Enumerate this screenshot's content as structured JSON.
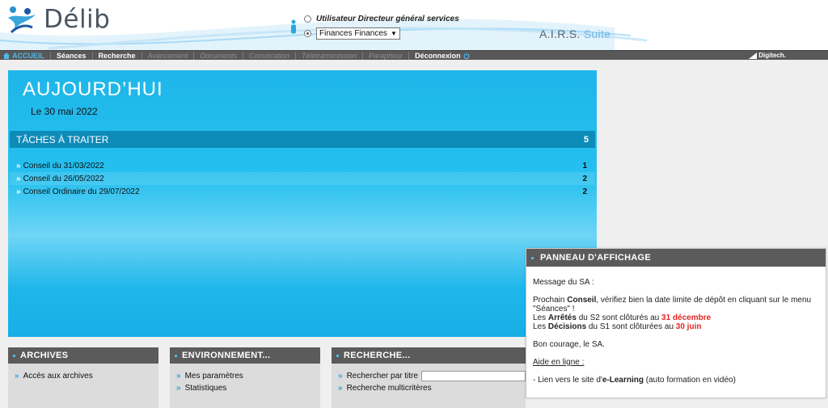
{
  "header": {
    "logo_text": "Délib",
    "user_label": "Utilisateur Directeur général services",
    "service_select": "Finances Finances",
    "brand_main": "A.I.R.S.",
    "brand_suite": "Suite",
    "accent_color": "#1fb6ea"
  },
  "nav": {
    "items": [
      {
        "label": "ACCUEIL",
        "state": "active"
      },
      {
        "label": "Séances",
        "state": "enabled"
      },
      {
        "label": "Recherche",
        "state": "enabled"
      },
      {
        "label": "Avancement",
        "state": "disabled"
      },
      {
        "label": "Documents",
        "state": "disabled"
      },
      {
        "label": "Convocation",
        "state": "disabled"
      },
      {
        "label": "Télétransmission",
        "state": "disabled"
      },
      {
        "label": "Parapheur",
        "state": "disabled"
      },
      {
        "label": "Déconnexion",
        "state": "enabled"
      }
    ],
    "partner": "Digitech."
  },
  "today": {
    "title": "AUJOURD’HUI",
    "date": "Le 30 mai 2022",
    "tasks_title": "TÂCHES À TRAITER",
    "tasks_count": "5",
    "tasks": [
      {
        "label": "Conseil du 31/03/2022",
        "count": "1"
      },
      {
        "label": "Conseil du 26/05/2022",
        "count": "2"
      },
      {
        "label": "Conseil Ordinaire du 29/07/2022",
        "count": "2"
      }
    ]
  },
  "panels": {
    "archives": {
      "title": "ARCHIVES",
      "links": [
        "Accès aux archives"
      ]
    },
    "environnement": {
      "title": "ENVIRONNEMENT...",
      "links": [
        "Mes paramètres",
        "Statistiques"
      ]
    },
    "recherche": {
      "title": "RECHERCHE...",
      "links": [
        "Rechercher par titre",
        "Recherche multicritères"
      ]
    }
  },
  "billboard": {
    "title": "PANNEAU D'AFFICHAGE",
    "intro": "Message du SA :",
    "line1_pre": "Prochain ",
    "line1_bold": "Conseil",
    "line1_post": ", vérifiez bien la date limite de dépôt en cliquant sur le menu \"Séances\" !",
    "line2_pre": "Les ",
    "line2_bold": "Arrêtés",
    "line2_mid": " du S2 sont clôturés au ",
    "line2_date": "31 décembre",
    "line3_pre": "Les ",
    "line3_bold": "Décisions",
    "line3_mid": " du S1 sont clôturées au ",
    "line3_date": "30 juin",
    "signoff": "Bon courage, le SA.",
    "help_title": "Aide en ligne :",
    "help_pre": "- Lien vers le site d'",
    "help_bold": "e-Learning",
    "help_post": " (auto formation en vidéo)"
  }
}
